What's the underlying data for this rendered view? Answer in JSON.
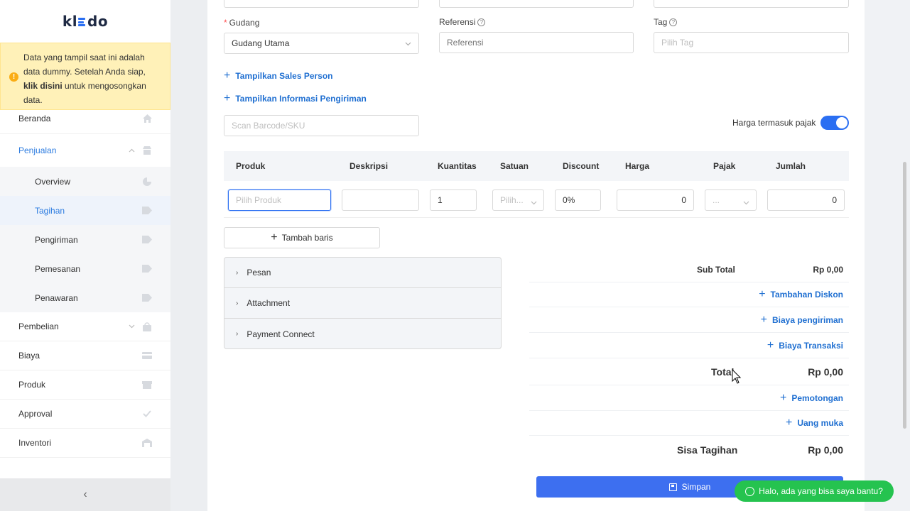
{
  "brand": {
    "logo_text_left": "kl",
    "logo_text_right": "do"
  },
  "notice": {
    "text_before": "Data yang tampil saat ini adalah data dummy. Setelah Anda siap, ",
    "link": "klik disini",
    "text_after": " untuk mengosongkan data."
  },
  "sidebar": {
    "items": [
      {
        "label": "Beranda",
        "icon": "home-icon"
      },
      {
        "label": "Penjualan",
        "icon": "shop-icon"
      },
      {
        "label": "Pembelian",
        "icon": "shopping-bag-icon"
      },
      {
        "label": "Biaya",
        "icon": "credit-card-icon"
      },
      {
        "label": "Produk",
        "icon": "box-icon"
      },
      {
        "label": "Approval",
        "icon": "check-icon"
      },
      {
        "label": "Inventori",
        "icon": "warehouse-icon"
      }
    ],
    "subitems": [
      {
        "label": "Overview",
        "icon": "pie-chart-icon"
      },
      {
        "label": "Tagihan",
        "icon": "tag-icon"
      },
      {
        "label": "Pengiriman",
        "icon": "tag-icon"
      },
      {
        "label": "Pemesanan",
        "icon": "tag-icon"
      },
      {
        "label": "Penawaran",
        "icon": "tag-icon"
      }
    ],
    "collapse_glyph": "‹"
  },
  "form": {
    "gudang_label": "Gudang",
    "gudang_value": "Gudang Utama",
    "referensi_label": "Referensi",
    "referensi_placeholder": "Referensi",
    "tag_label": "Tag",
    "tag_placeholder": "Pilih Tag",
    "show_sales_person": "Tampilkan Sales Person",
    "show_shipping_info": "Tampilkan Informasi Pengiriman",
    "barcode_placeholder": "Scan Barcode/SKU",
    "tax_inclusive_label": "Harga termasuk pajak",
    "tax_inclusive_on": true
  },
  "table": {
    "headers": [
      "Produk",
      "Deskripsi",
      "Kuantitas",
      "Satuan",
      "Discount",
      "Harga",
      "Pajak",
      "Jumlah"
    ],
    "row": {
      "produk_placeholder": "Pilih Produk",
      "deskripsi": "",
      "kuantitas": "1",
      "satuan_placeholder": "Pilih...",
      "discount": "0%",
      "harga": "0",
      "pajak_placeholder": "...",
      "jumlah": "0"
    },
    "add_row": "Tambah baris"
  },
  "panels": [
    "Pesan",
    "Attachment",
    "Payment Connect"
  ],
  "summary": {
    "subtotal_label": "Sub Total",
    "subtotal_value": "Rp 0,00",
    "add_discount": "Tambahan Diskon",
    "shipping_cost": "Biaya pengiriman",
    "transaction_fee": "Biaya Transaksi",
    "total_label": "Total",
    "total_value": "Rp 0,00",
    "deduction": "Pemotongan",
    "down_payment": "Uang muka",
    "remaining_label": "Sisa Tagihan",
    "remaining_value": "Rp 0,00"
  },
  "actions": {
    "save": "Simpan"
  },
  "chat": {
    "label": "Halo, ada yang bisa saya bantu?"
  },
  "colors": {
    "primary": "#2b6ff2",
    "link": "#1f6fd1",
    "notice_bg": "#fff1b8",
    "chat_green": "#25c34f",
    "save_btn": "#3d6ff0"
  }
}
